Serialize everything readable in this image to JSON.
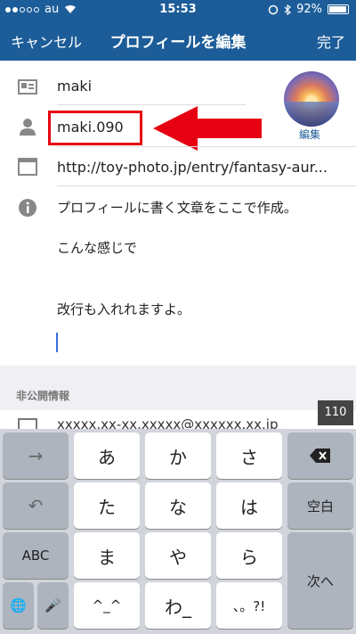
{
  "status_bar": {
    "carrier": "au",
    "time": "15:53",
    "battery": "92%"
  },
  "nav": {
    "cancel": "キャンセル",
    "title": "プロフィールを編集",
    "done": "完了"
  },
  "profile": {
    "name": "maki",
    "username": "maki.090",
    "website": "http://toy-photo.jp/entry/fantasy-aur...",
    "avatar_edit": "編集",
    "bio_lines": [
      "プロフィールに書く文章をここで作成。",
      "こんな感じで",
      "改行も入れれますよ。"
    ]
  },
  "private_section": {
    "header": "非公開情報",
    "email": "xxxxx.xx-xx.xxxxx@xxxxxx.xx.jp",
    "char_count": "110"
  },
  "keyboard": {
    "keys": {
      "next": "→",
      "a": "あ",
      "ka": "か",
      "sa": "さ",
      "undo": "↶",
      "ta": "た",
      "na": "な",
      "ha": "は",
      "space": "空白",
      "abc": "ABC",
      "ma": "ま",
      "ya": "や",
      "ra": "ら",
      "next_line": "次へ",
      "dakuten": "^_^",
      "wa": "わ_",
      "punct": "、。?!",
      "globe": "🌐",
      "mic": "🎤",
      "delete": "⌫"
    }
  },
  "colors": {
    "accent": "#1c5d99",
    "highlight": "#e60012",
    "caret": "#3a6fe0"
  }
}
